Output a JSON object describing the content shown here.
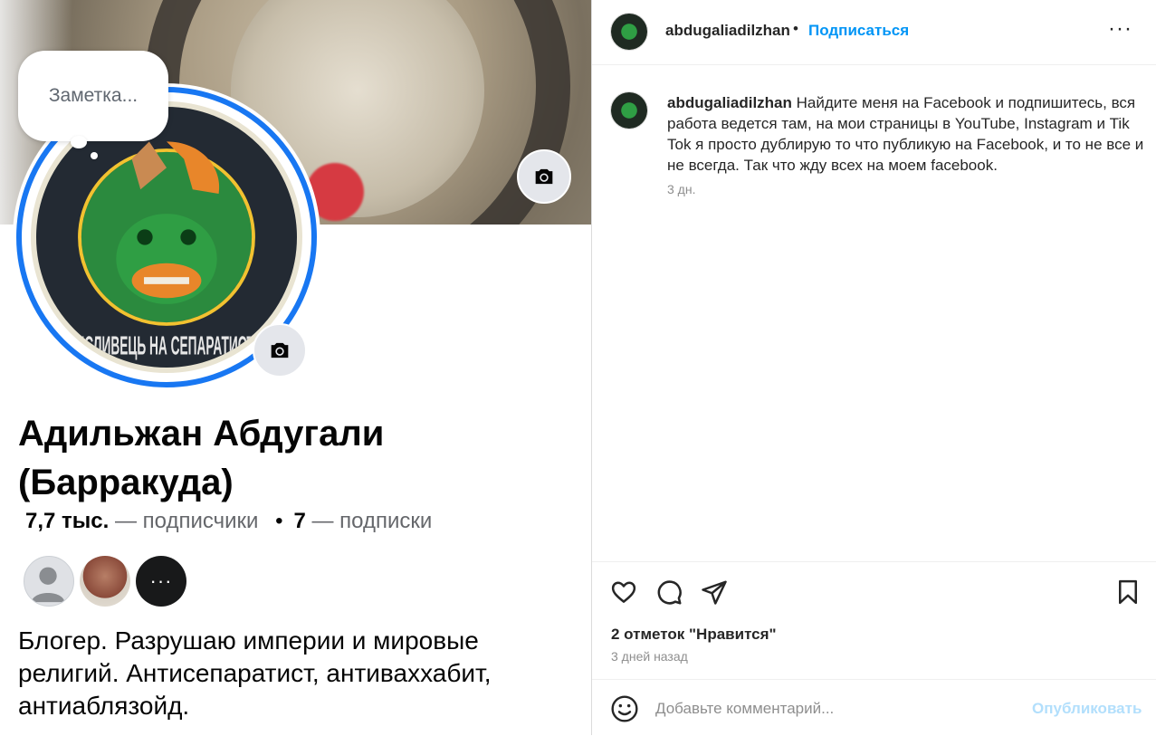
{
  "post_image": {
    "note_placeholder": "Заметка...",
    "badge_text": "ПИСЛИВЕЦЬ НА СЕПАРАТИСТІВ",
    "profile_name": "Адильжан Абдугали (Барракуда)",
    "followers_count": "7,7 тыс.",
    "followers_label": " — подписчики",
    "separator": "•",
    "following_count": "7",
    "following_label": " — подписки",
    "more_friends": "···",
    "bio": "Блогер. Разрушаю империи и мировые религий. Антисепаратист, антиваххабит, антиаблязойд."
  },
  "header": {
    "username": "abdugaliadilzhan",
    "dot": "•",
    "follow_label": "Подписаться",
    "more": "···"
  },
  "caption": {
    "username": "abdugaliadilzhan",
    "text": "Найдите меня на Facebook и подпишитесь, вся работа ведется там, на мои страницы в YouTube, Instagram и Tik Tok я просто дублирую то что публикую на Facebook, и то не все и не всегда. Так что жду всех на моем facebook.",
    "time": "3 дн."
  },
  "actions": {
    "likes": "2 отметок \"Нравится\"",
    "date": "3 дней назад"
  },
  "comment": {
    "placeholder": "Добавьте комментарий...",
    "publish_label": "Опубликовать"
  },
  "icons": {
    "like": "heart-icon",
    "comment": "comment-icon",
    "share": "share-icon",
    "save": "bookmark-icon",
    "emoji": "emoji-icon",
    "camera": "camera-icon",
    "more": "more-icon"
  }
}
